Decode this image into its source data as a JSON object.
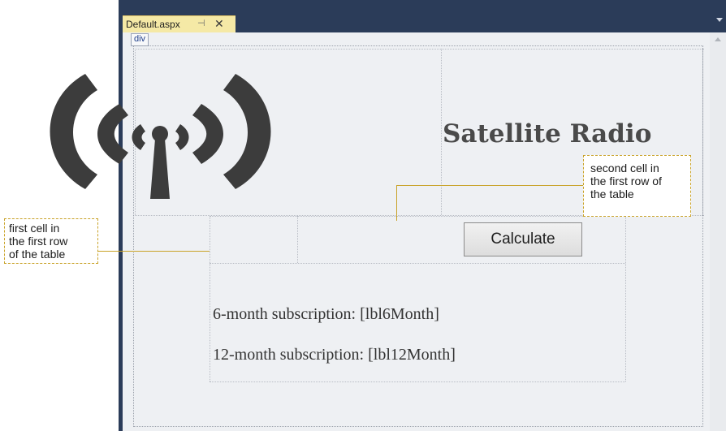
{
  "tab": {
    "title": "Default.aspx",
    "pin_glyph": "⊣",
    "close_glyph": "✕"
  },
  "design": {
    "div_tag": "div",
    "site_title": "Satellite Radio",
    "calculate_label": "Calculate",
    "label_6month": "6-month subscription:  [lbl6Month]",
    "label_12month": "12-month subscription: [lbl12Month]"
  },
  "callouts": {
    "first_cell": [
      "first cell in",
      "the first row",
      "of the table"
    ],
    "second_cell": [
      "second cell in",
      "the first row of",
      "the table"
    ]
  },
  "colors": {
    "accent": "#c9a227",
    "ide_frame": "#2b3c59",
    "tab_active": "#f5e9a6"
  },
  "icons": {
    "logo": "satellite-radio-waves-icon",
    "pin": "pin-icon",
    "close": "close-icon"
  }
}
